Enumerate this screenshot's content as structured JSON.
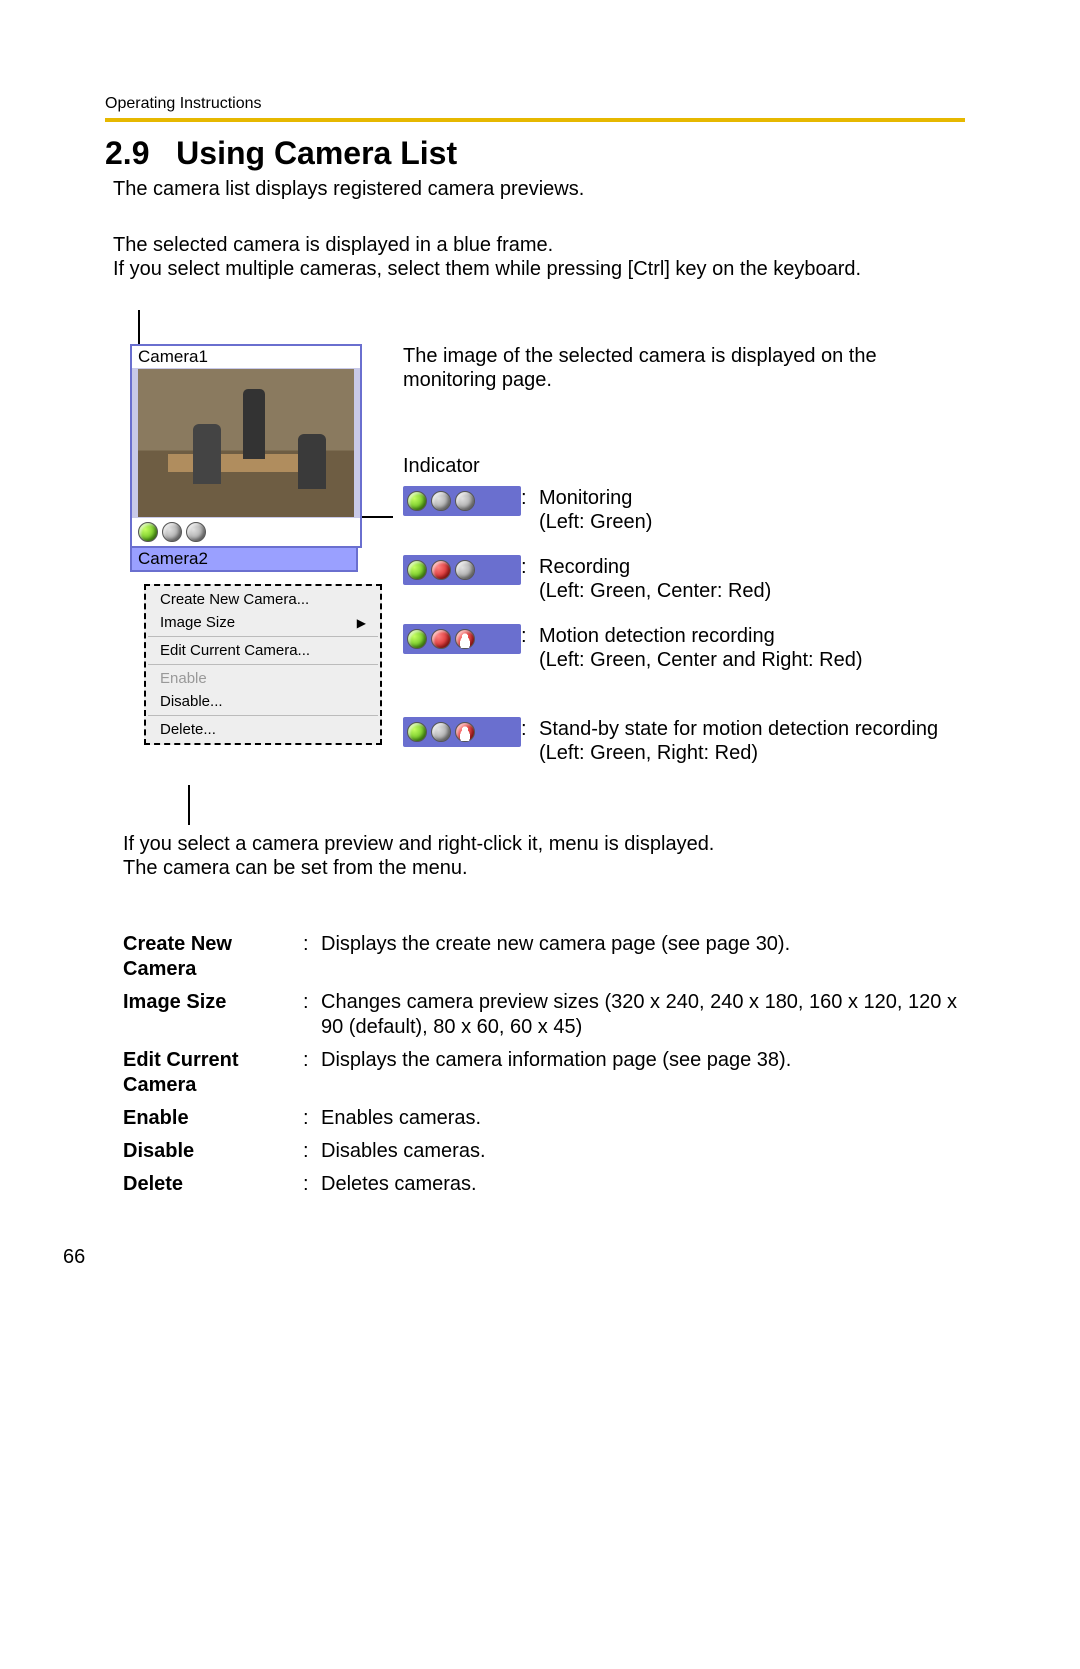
{
  "running_head": "Operating Instructions",
  "section_number": "2.9",
  "section_title": "Using Camera List",
  "intro": "The camera list displays registered camera previews.",
  "selected_info_line1": "The selected camera is displayed in a blue frame.",
  "selected_info_line2": "If you select multiple cameras, select them while pressing [Ctrl] key on the keyboard.",
  "camera1_label": "Camera1",
  "camera2_label": "Camera2",
  "context_menu": {
    "create": "Create New Camera...",
    "image_size": "Image Size",
    "edit": "Edit Current Camera...",
    "enable": "Enable",
    "disable": "Disable...",
    "delete": "Delete..."
  },
  "right_text_monitoring": "The image of the selected camera is displayed on the monitoring page.",
  "indicator_heading": "Indicator",
  "indicators": [
    {
      "label": "Monitoring",
      "detail": "(Left: Green)"
    },
    {
      "label": "Recording",
      "detail": "(Left: Green, Center: Red)"
    },
    {
      "label": "Motion detection recording",
      "detail": "(Left: Green, Center and Right: Red)"
    },
    {
      "label": "Stand-by state for motion detection recording",
      "detail": "(Left: Green, Right: Red)"
    }
  ],
  "right_click_note": "If you select a camera preview and right-click it, menu is displayed. The camera can be set from the menu.",
  "defs": [
    {
      "term": "Create New Camera",
      "desc": "Displays the create new camera page (see page 30)."
    },
    {
      "term": "Image Size",
      "desc": "Changes camera preview sizes (320 x 240, 240 x 180, 160 x 120, 120 x 90 (default), 80 x 60, 60 x 45)"
    },
    {
      "term": "Edit Current Camera",
      "desc": "Displays the camera information page (see page 38)."
    },
    {
      "term": "Enable",
      "desc": "Enables cameras."
    },
    {
      "term": "Disable",
      "desc": "Disables cameras."
    },
    {
      "term": "Delete",
      "desc": "Deletes cameras."
    }
  ],
  "page_number": "66"
}
